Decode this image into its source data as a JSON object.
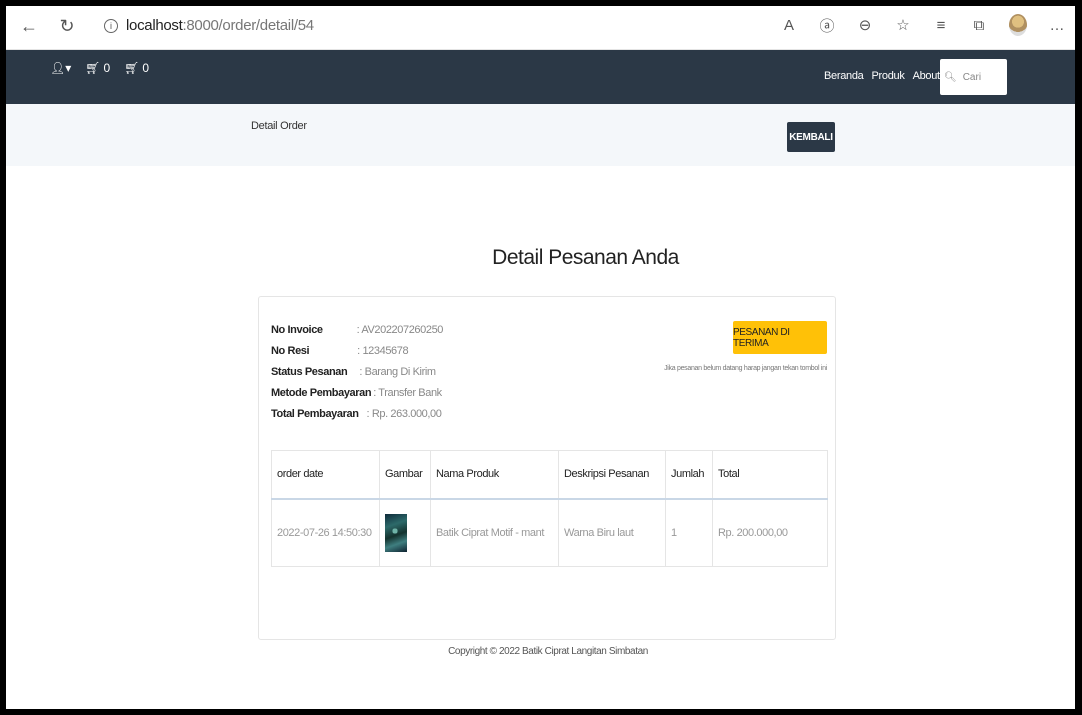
{
  "browser": {
    "url_host": "localhost",
    "url_path": ":8000/order/detail/54"
  },
  "nav": {
    "user_label": "",
    "cart_count": "0",
    "order_count": "0",
    "links": [
      "Beranda",
      "Produk",
      "About Us"
    ],
    "search_placeholder": "Cari"
  },
  "subheader": {
    "title": "Detail Order",
    "back_button": "KEMBALI"
  },
  "main": {
    "title": "Detail Pesanan Anda"
  },
  "order": {
    "invoice_label": "No Invoice",
    "invoice_value": ": AV202207260250",
    "resi_label": "No Resi",
    "resi_value": ": 12345678",
    "status_label": "Status Pesanan",
    "status_value": ": Barang Di Kirim",
    "method_label": "Metode Pembayaran",
    "method_value": ": Transfer Bank",
    "total_label": "Total Pembayaran",
    "total_value": ": Rp. 263.000,00",
    "status_button": "PESANAN DI TERIMA",
    "note": "Jika pesanan belum datang harap jangan tekan tombol ini"
  },
  "table": {
    "headers": [
      "order date",
      "Gambar",
      "Nama Produk",
      "Deskripsi Pesanan",
      "Jumlah",
      "Total"
    ],
    "rows": [
      {
        "date": "2022-07-26 14:50:30",
        "product": "Batik Ciprat Motif - mant",
        "desc": "Warna Biru laut",
        "qty": "1",
        "total": "Rp. 200.000,00"
      }
    ]
  },
  "footer": {
    "copyright": "Copyright © 2022 Batik Ciprat Langitan Simbatan"
  }
}
